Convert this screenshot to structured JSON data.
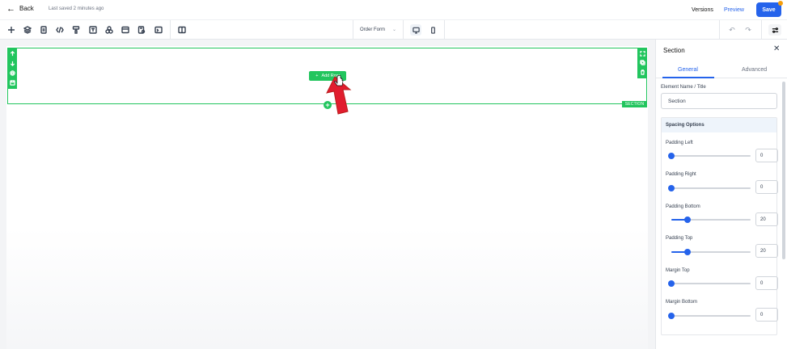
{
  "topbar": {
    "back_label": "Back",
    "saved_status": "Last saved 2 minutes ago",
    "versions_label": "Versions",
    "preview_label": "Preview",
    "save_label": "Save"
  },
  "toolbar": {
    "tools": [
      "add-icon",
      "layers-icon",
      "page-icon",
      "code-icon",
      "paint-icon",
      "text-icon",
      "shapes-icon",
      "layout-icon",
      "form-icon",
      "terminal-icon",
      "columns-icon"
    ],
    "page_select": "Order Form",
    "devices": [
      "desktop-icon",
      "mobile-icon"
    ],
    "active_device": "desktop-icon"
  },
  "canvas": {
    "add_row_label": "Add Row",
    "section_tag": "SECTION",
    "accent_color": "#22c55e"
  },
  "panel": {
    "title": "Section",
    "tabs": [
      {
        "label": "General",
        "active": true
      },
      {
        "label": "Advanced",
        "active": false
      }
    ],
    "element_name_label": "Element Name / Title",
    "element_name_value": "Section",
    "spacing_header": "Spacing Options",
    "fields": [
      {
        "label": "Padding Left",
        "value": "0",
        "fraction": 0.0
      },
      {
        "label": "Padding Right",
        "value": "0",
        "fraction": 0.0
      },
      {
        "label": "Padding Bottom",
        "value": "20",
        "fraction": 0.2
      },
      {
        "label": "Padding Top",
        "value": "20",
        "fraction": 0.2
      },
      {
        "label": "Margin Top",
        "value": "0",
        "fraction": 0.0
      },
      {
        "label": "Margin Bottom",
        "value": "0",
        "fraction": 0.0
      }
    ]
  }
}
